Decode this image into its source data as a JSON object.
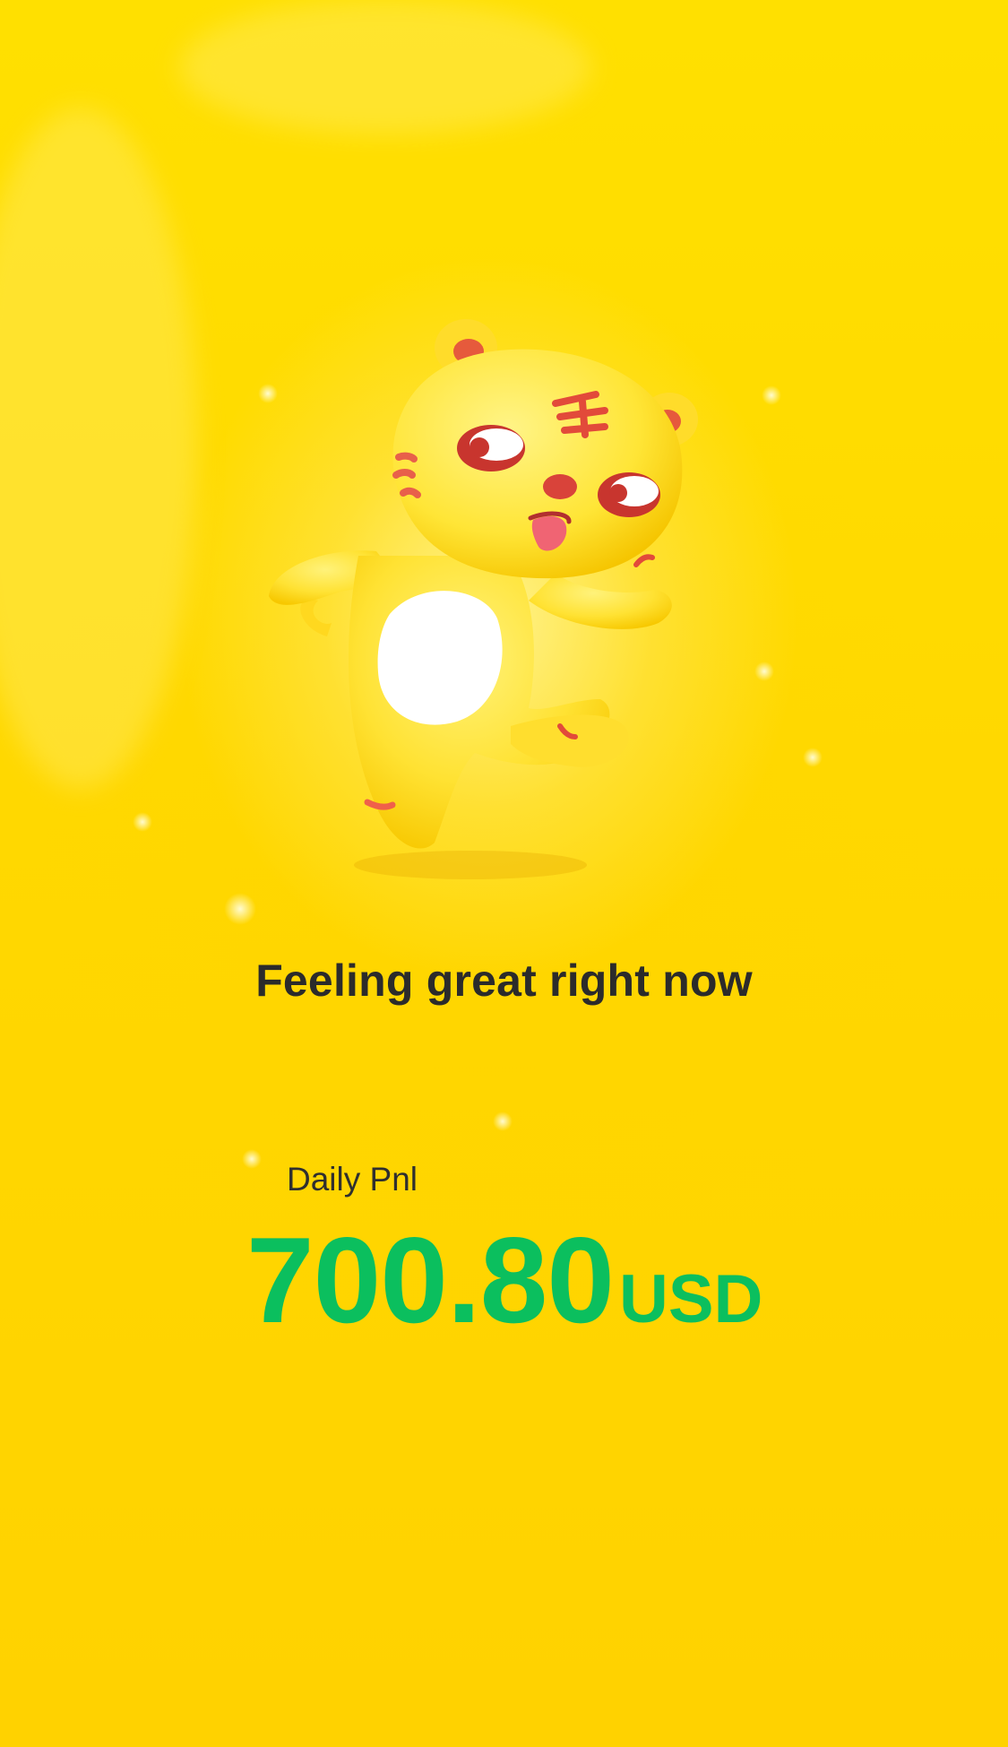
{
  "mascot": {
    "icon": "tiger-mascot-icon"
  },
  "headline": "Feeling great right now",
  "pnl": {
    "label": "Daily Pnl",
    "amount": "700.80",
    "unit": "USD"
  },
  "colors": {
    "background": "#FFD600",
    "pnl_positive": "#0BBF5E",
    "text": "#2B2B2B"
  }
}
